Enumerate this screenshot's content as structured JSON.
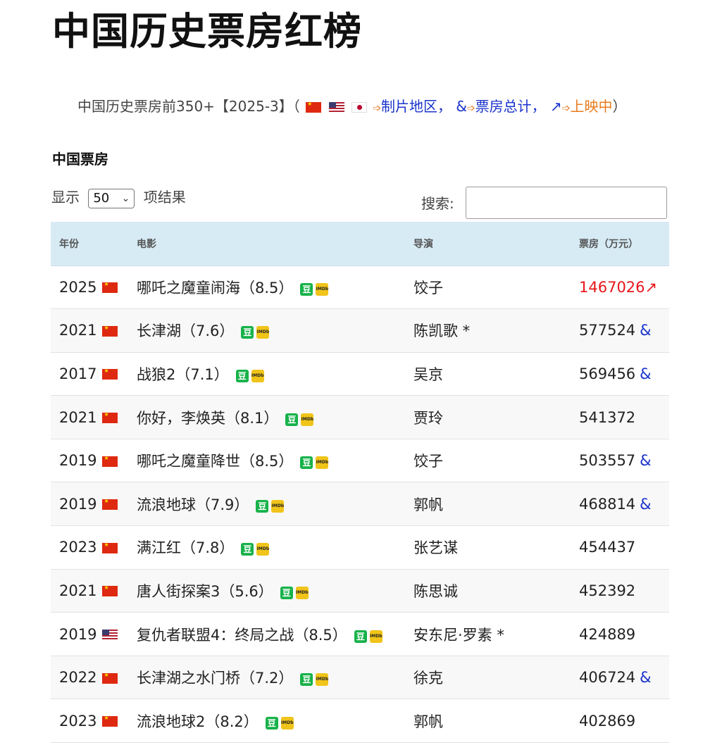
{
  "page_title": "中国历史票房红榜",
  "legend": {
    "intro": "中国历史票房前350+【2025-3】（",
    "region_label": "制片地区，",
    "amp_symbol": "&",
    "total_label": "票房总计，",
    "up_symbol": "↗",
    "showing_label": "上映中",
    "close": "）",
    "pointer_symbol": "➩"
  },
  "section_title": "中国票房",
  "length_control": {
    "prefix": "显示",
    "value": "50",
    "suffix": "项结果"
  },
  "search": {
    "label": "搜索:",
    "value": ""
  },
  "table": {
    "headers": {
      "year": "年份",
      "film": "电影",
      "director": "导演",
      "box_office": "票房（万元）"
    },
    "rows": [
      {
        "year": "2025",
        "flag": "cn",
        "film": "哪吒之魔童闹海（8.5）",
        "director": "饺子",
        "box_office": "1467026↗",
        "highlight": true,
        "amp": ""
      },
      {
        "year": "2021",
        "flag": "cn",
        "film": "长津湖（7.6）",
        "director": "陈凯歌 *",
        "box_office": "577524",
        "highlight": false,
        "amp": "&"
      },
      {
        "year": "2017",
        "flag": "cn",
        "film": "战狼2（7.1）",
        "director": "吴京",
        "box_office": "569456",
        "highlight": false,
        "amp": "&"
      },
      {
        "year": "2021",
        "flag": "cn",
        "film": "你好，李焕英（8.1）",
        "director": "贾玲",
        "box_office": "541372",
        "highlight": false,
        "amp": ""
      },
      {
        "year": "2019",
        "flag": "cn",
        "film": "哪吒之魔童降世（8.5）",
        "director": "饺子",
        "box_office": "503557",
        "highlight": false,
        "amp": "&"
      },
      {
        "year": "2019",
        "flag": "cn",
        "film": "流浪地球（7.9）",
        "director": "郭帆",
        "box_office": "468814",
        "highlight": false,
        "amp": "&"
      },
      {
        "year": "2023",
        "flag": "cn",
        "film": "满江红（7.8）",
        "director": "张艺谋",
        "box_office": "454437",
        "highlight": false,
        "amp": ""
      },
      {
        "year": "2021",
        "flag": "cn",
        "film": "唐人街探案3（5.6）",
        "director": "陈思诚",
        "box_office": "452392",
        "highlight": false,
        "amp": ""
      },
      {
        "year": "2019",
        "flag": "us",
        "film": "复仇者联盟4：终局之战（8.5）",
        "director": "安东尼·罗素 *",
        "box_office": "424889",
        "highlight": false,
        "amp": ""
      },
      {
        "year": "2022",
        "flag": "cn",
        "film": "长津湖之水门桥（7.2）",
        "director": "徐克",
        "box_office": "406724",
        "highlight": false,
        "amp": "&"
      },
      {
        "year": "2023",
        "flag": "cn",
        "film": "流浪地球2（8.2）",
        "director": "郭帆",
        "box_office": "402869",
        "highlight": false,
        "amp": ""
      }
    ]
  },
  "badges": {
    "douban": "豆",
    "imdb": "IMDb"
  },
  "colors": {
    "header_bg": "#d7ebf5",
    "red": "#e8161b",
    "blue": "#1a33cc",
    "orange": "#e87b1e",
    "douban_green": "#17b24a",
    "imdb_yellow": "#f0c419"
  }
}
